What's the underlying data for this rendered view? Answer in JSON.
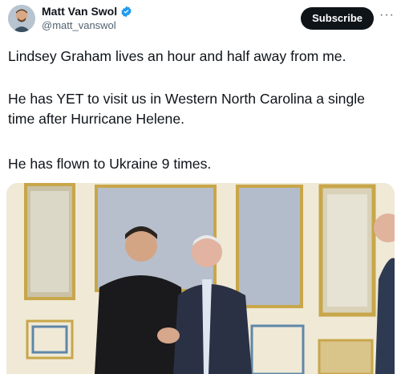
{
  "author": {
    "display_name": "Matt Van Swol",
    "handle": "@matt_vanswol",
    "verified": true,
    "verified_color": "#1d9bf0"
  },
  "actions": {
    "subscribe_label": "Subscribe",
    "more_label": "···"
  },
  "tweet": {
    "paragraphs": [
      "Lindsey Graham lives an hour and half away from me.",
      "He has YET to visit us in Western North Carolina a single time after Hurricane Helene.",
      "He has flown to Ukraine 9 times."
    ]
  },
  "icons": {
    "verified": "verified-badge-icon",
    "more": "more-options-icon"
  }
}
